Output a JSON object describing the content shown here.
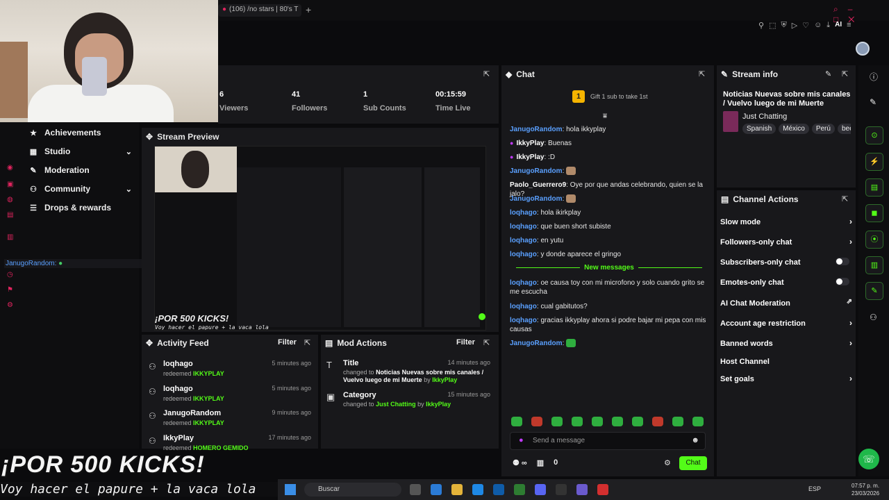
{
  "browser": {
    "tab_title": "(106) /no stars | 80's T",
    "new_tab": "+",
    "toolbar_ai": "AI"
  },
  "webcam": {
    "description_alt": ""
  },
  "nav": {
    "items": [
      {
        "label": "Achievements",
        "has_chevron": false
      },
      {
        "label": "Studio",
        "has_chevron": true
      },
      {
        "label": "Moderation",
        "has_chevron": false
      },
      {
        "label": "Community",
        "has_chevron": true
      },
      {
        "label": "Drops & rewards",
        "has_chevron": false
      }
    ]
  },
  "overlay_chat": {
    "user": "JanugoRandom:"
  },
  "stats": [
    {
      "value": "6",
      "label": "Viewers"
    },
    {
      "value": "41",
      "label": "Followers"
    },
    {
      "value": "1",
      "label": "Sub Counts"
    },
    {
      "value": "00:15:59",
      "label": "Time Live"
    }
  ],
  "preview": {
    "title": "Stream Preview",
    "kicks": "¡POR 500 KICKS!",
    "papure": "Voy hacer el papure + la vaca lola"
  },
  "activity": {
    "title": "Activity Feed",
    "filter": "Filter",
    "rows": [
      {
        "user": "loqhago",
        "action": "redeemed",
        "target": "IKKYPLAY",
        "time": "5 minutes ago"
      },
      {
        "user": "loqhago",
        "action": "redeemed",
        "target": "IKKYPLAY",
        "time": "5 minutes ago"
      },
      {
        "user": "JanugoRandom",
        "action": "redeemed",
        "target": "IKKYPLAY",
        "time": "9 minutes ago"
      },
      {
        "user": "IkkyPlay",
        "action": "redeemed",
        "target": "HOMERO GEMIDO",
        "time": "17 minutes ago"
      }
    ]
  },
  "mod_actions": {
    "title": "Mod Actions",
    "filter": "Filter",
    "rows": [
      {
        "title": "Title",
        "time": "14 minutes ago",
        "prefix": "changed to",
        "value": "Noticias Nuevas sobre mis canales / Vuelvo luego de mi Muerte",
        "by": "by",
        "who": "IkkyPlay"
      },
      {
        "title": "Category",
        "time": "15 minutes ago",
        "prefix": "changed to",
        "value": "Just Chatting",
        "by": "by",
        "who": "IkkyPlay"
      }
    ]
  },
  "chat": {
    "title": "Chat",
    "gift_badge": "1",
    "gift_text": "Gift 1 sub to take 1st",
    "new_messages": "New messages",
    "messages": [
      {
        "user": "JanugoRandom",
        "text": "hola ikkyplay",
        "color": "blue",
        "badge": false,
        "emote": false
      },
      {
        "user": "IkkyPlay",
        "text": "Buenas",
        "color": "white",
        "badge": true,
        "emote": false
      },
      {
        "user": "IkkyPlay",
        "text": ":D",
        "color": "white",
        "badge": true,
        "emote": false
      },
      {
        "user": "JanugoRandom",
        "text": "",
        "color": "blue",
        "badge": false,
        "emote": true
      },
      {
        "user": "Paolo_Guerrero9",
        "text": "Oye por que andas celebrando, quien se la jalo?",
        "color": "white",
        "badge": false,
        "emote": false
      },
      {
        "user": "JanugoRandom",
        "text": "",
        "color": "blue",
        "badge": false,
        "emote": true
      },
      {
        "user": "loqhago",
        "text": "hola ikirkplay",
        "color": "blue",
        "badge": false,
        "emote": false
      },
      {
        "user": "loqhago",
        "text": "que buen short subiste",
        "color": "blue",
        "badge": false,
        "emote": false
      },
      {
        "user": "loqhago",
        "text": "en yutu",
        "color": "blue",
        "badge": false,
        "emote": false
      },
      {
        "user": "loqhago",
        "text": "y donde aparece el gringo",
        "color": "blue",
        "badge": false,
        "emote": false
      },
      {
        "user": "loqhago",
        "text": "oe causa toy con mi microfono y solo cuando grito se me escucha",
        "color": "blue",
        "badge": false,
        "emote": false
      },
      {
        "user": "loqhago",
        "text": "cual gabitutos?",
        "color": "blue",
        "badge": false,
        "emote": false
      },
      {
        "user": "loqhago",
        "text": "gracias ikkyplay ahora si podre bajar mi pepa con mis causas",
        "color": "blue",
        "badge": false,
        "emote": false
      },
      {
        "user": "JanugoRandom",
        "text": "",
        "color": "blue",
        "badge": false,
        "emote": true
      }
    ],
    "input_placeholder": "Send a message",
    "footer_count": "0",
    "send_label": "Chat"
  },
  "stream_info": {
    "title": "Stream info",
    "stream_title": "Noticias Nuevas sobre mis canales / Vuelvo luego de mi Muerte",
    "category": "Just Chatting",
    "tags": [
      "Spanish",
      "México",
      "Perú",
      "bee"
    ]
  },
  "channel_actions": {
    "title": "Channel Actions",
    "rows": [
      {
        "label": "Slow mode",
        "control": "chevron"
      },
      {
        "label": "Followers-only chat",
        "control": "chevron"
      },
      {
        "label": "Subscribers-only chat",
        "control": "toggle"
      },
      {
        "label": "Emotes-only chat",
        "control": "toggle"
      },
      {
        "label": "AI Chat Moderation",
        "control": "external"
      },
      {
        "label": "Account age restriction",
        "control": "chevron"
      },
      {
        "label": "Banned words",
        "control": "chevron"
      },
      {
        "label": "Host Channel",
        "control": "none"
      },
      {
        "label": "Set goals",
        "control": "chevron"
      }
    ]
  },
  "overlay": {
    "kicks": "¡POR 500 KICKS!",
    "papure": "Voy hacer el papure + la vaca lola"
  },
  "taskbar": {
    "search": "Buscar",
    "lang": "ESP",
    "time": "07:57 p. m.",
    "date": "23/03/2026"
  },
  "colors": {
    "accent": "#53fc18",
    "panel": "#18181b",
    "bg": "#0b0b0d",
    "link": "#5aa0ff",
    "danger": "#e0245e"
  }
}
